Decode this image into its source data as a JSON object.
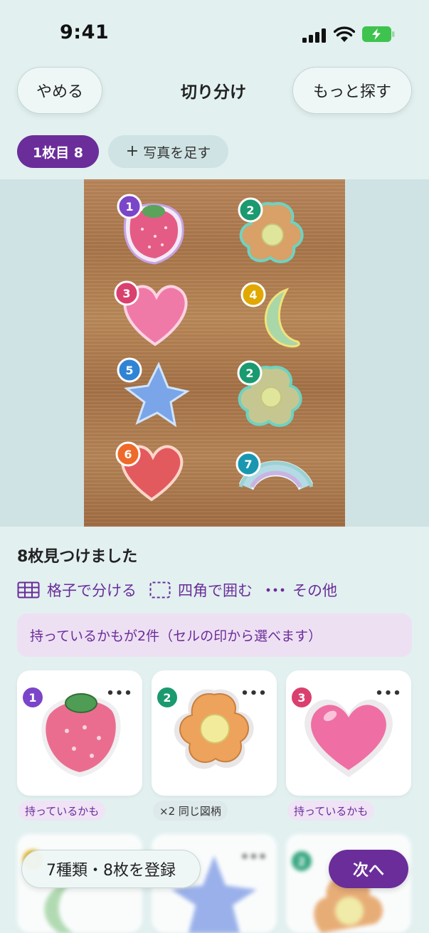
{
  "status_bar": {
    "time": "9:41",
    "icons": [
      "signal-icon",
      "wifi-icon",
      "battery-charging-icon"
    ]
  },
  "header": {
    "quit_label": "やめる",
    "title": "切り分け",
    "more_label": "もっと探す"
  },
  "photos": {
    "active_chip": "1枚目 8",
    "add_label": "写真を足す",
    "add_icon": "plus-icon"
  },
  "photo_markers": [
    "1",
    "2",
    "3",
    "4",
    "5",
    "2",
    "6",
    "7"
  ],
  "summary": {
    "found_text": "8枚見つけました",
    "tools": [
      {
        "icon": "grid-icon",
        "label": "格子で分ける"
      },
      {
        "icon": "dashed-rect-icon",
        "label": "四角で囲む"
      },
      {
        "icon": "more-dots-icon",
        "label": "その他"
      }
    ],
    "info": "持っているかもが2件（セルの印から選べます）"
  },
  "cards": [
    {
      "number": "1",
      "name": "strawberry",
      "tag": "持っているかも",
      "tag_kind": "have",
      "badge_color": "#7b45c9"
    },
    {
      "number": "2",
      "name": "flower",
      "tag": "×2 同じ図柄",
      "tag_kind": "same",
      "badge_color": "#1a9a6e"
    },
    {
      "number": "3",
      "name": "heart-pink",
      "tag": "持っているかも",
      "tag_kind": "have",
      "badge_color": "#d9406e"
    }
  ],
  "row2_cards": [
    {
      "number": "4",
      "badge_color": "#e0a800"
    },
    {
      "number": "5",
      "badge_color": "#2f84d6"
    },
    {
      "number": "2",
      "badge_color": "#1a9a6e"
    }
  ],
  "card_menu_label": "•••",
  "bottom": {
    "register_label": "7種類・8枚を登録",
    "next_label": "次へ"
  },
  "colors": {
    "accent": "#6a2d9a",
    "background": "#e2f0f0",
    "info_bg": "#eee0f3"
  }
}
